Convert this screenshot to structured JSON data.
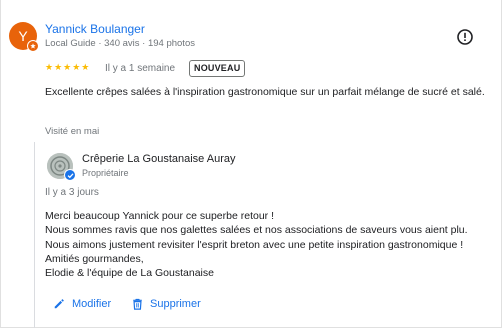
{
  "review": {
    "avatar_letter": "Y",
    "reviewer_name": "Yannick Boulanger",
    "reviewer_meta": "Local Guide · 340 avis · 194 photos",
    "stars": "★★★★★",
    "rating": 5,
    "date": "Il y a 1 semaine",
    "badge": "NOUVEAU",
    "text": "Excellente crêpes salées à l'inspiration gastronomique sur un parfait mélange de sucré et salé.",
    "visited": "Visité en mai"
  },
  "owner_reply": {
    "business_name": "Crêperie La Goustanaise Auray",
    "role": "Propriétaire",
    "date": "Il y a 3 jours",
    "lines": [
      "Merci beaucoup Yannick pour ce superbe retour !",
      "Nous sommes ravis que nos galettes salées et nos associations de saveurs vous aient plu.",
      "Nous aimons justement revisiter l'esprit breton avec une petite inspiration gastronomique !",
      "Amitiés gourmandes,",
      "Elodie & l'équipe de La Goustanaise"
    ],
    "actions": {
      "edit_label": "Modifier",
      "delete_label": "Supprimer"
    }
  },
  "colors": {
    "link": "#1a73e8",
    "avatar": "#e8630a",
    "star": "#fbbc04",
    "secondary_text": "#70757a"
  },
  "icons": [
    "local-guide-badge-icon",
    "report-icon",
    "verified-icon",
    "edit-pencil-icon",
    "trash-icon"
  ]
}
